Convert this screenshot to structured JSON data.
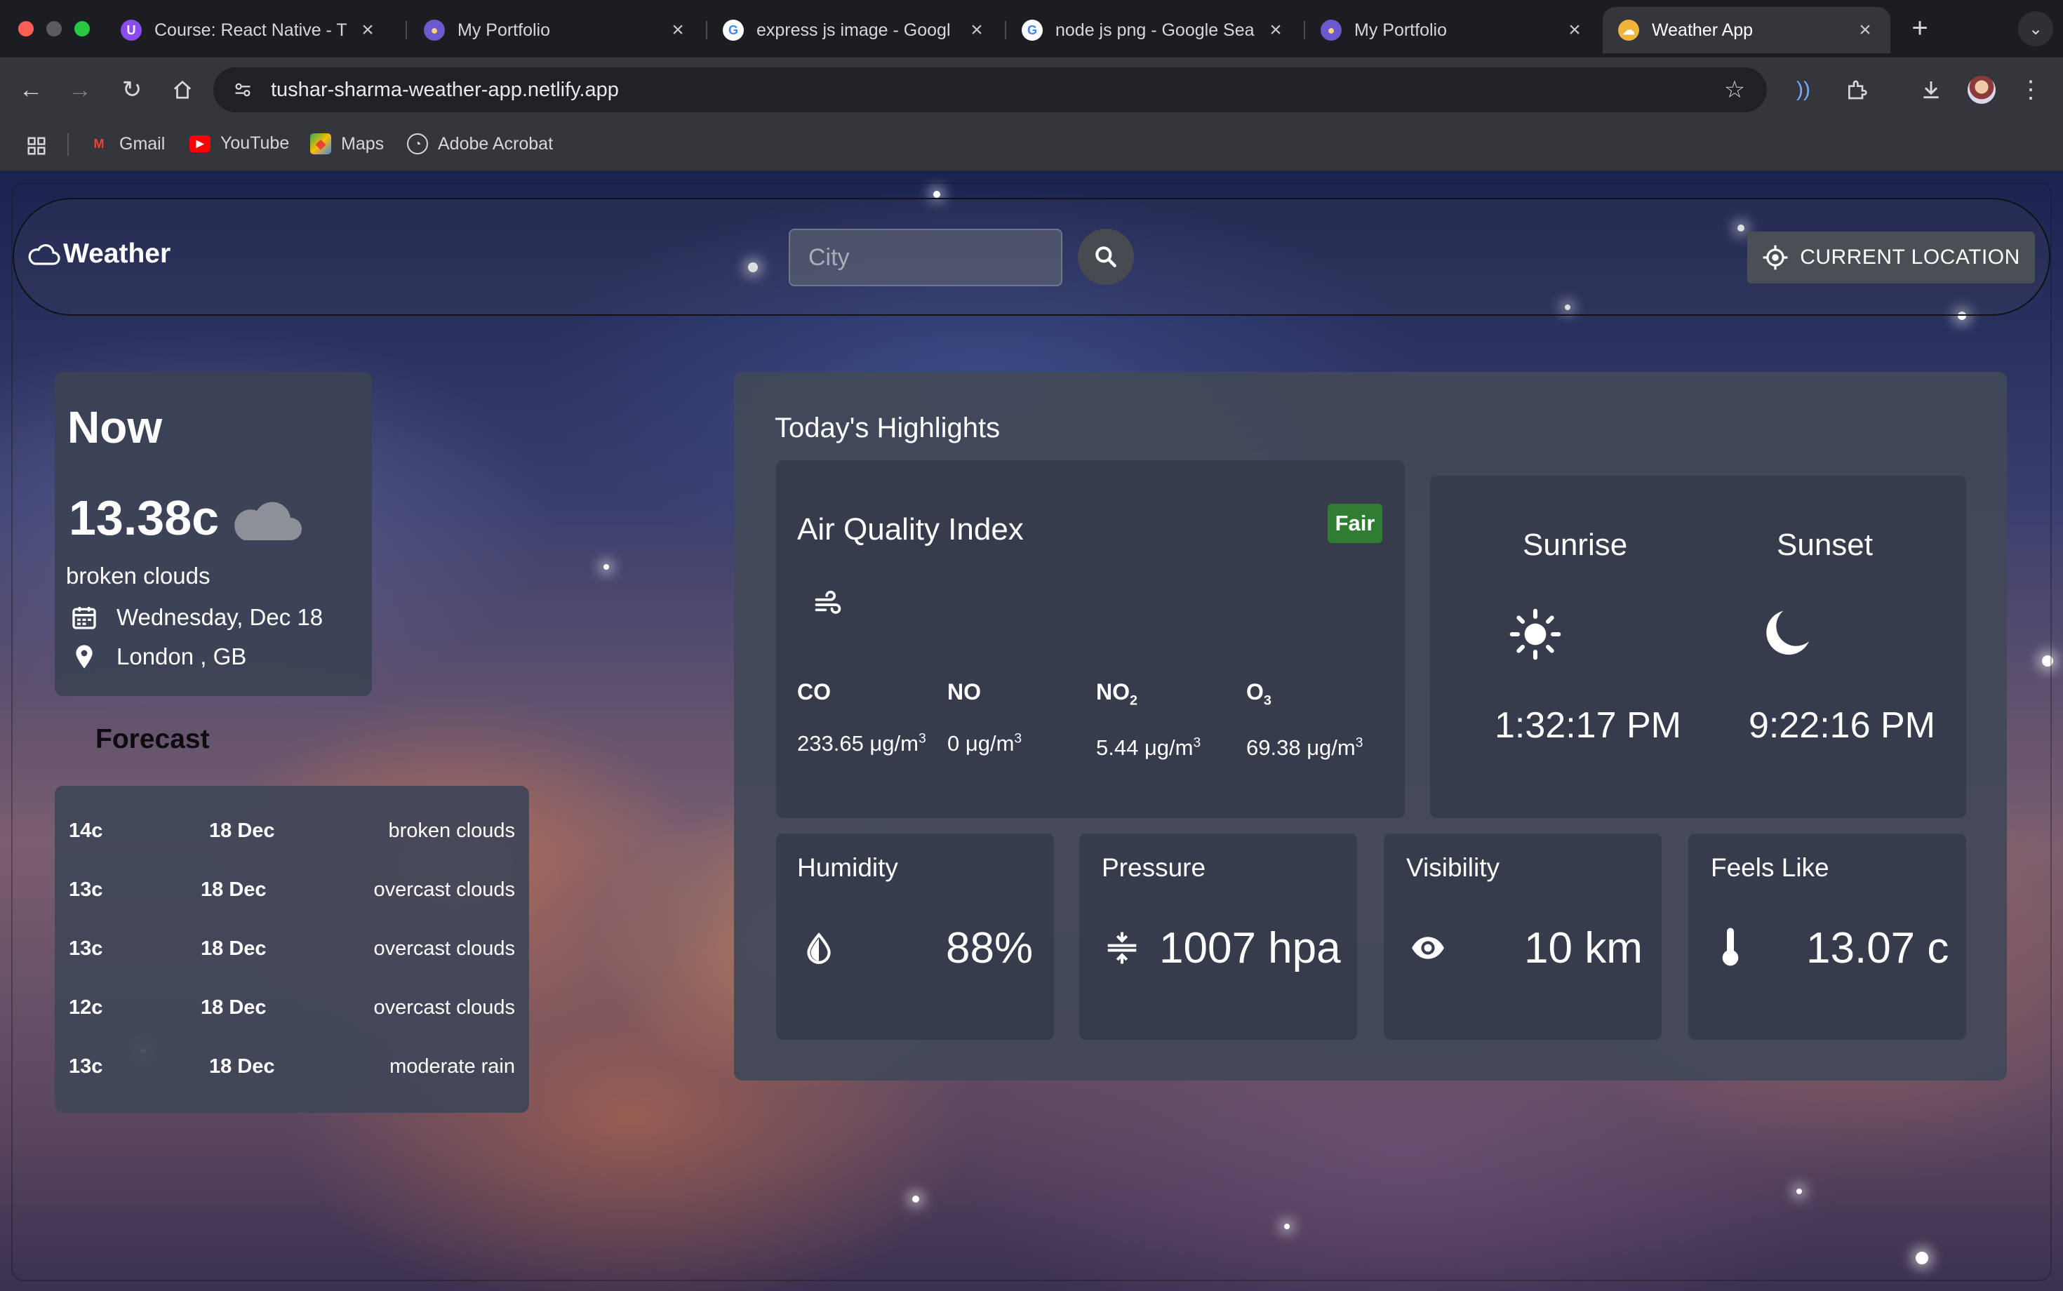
{
  "browser": {
    "tabs": [
      {
        "title": "Course: React Native - Th",
        "icon": "course-icon"
      },
      {
        "title": "My Portfolio",
        "icon": "portfolio-icon"
      },
      {
        "title": "express js image - Googl",
        "icon": "google-icon"
      },
      {
        "title": "node js png - Google Sea",
        "icon": "google-icon"
      },
      {
        "title": "My Portfolio",
        "icon": "portfolio-icon"
      },
      {
        "title": "Weather App",
        "icon": "weather-app-icon",
        "active": true
      }
    ],
    "url": "tushar-sharma-weather-app.netlify.app",
    "bookmarks": [
      {
        "label": "Gmail",
        "icon": "gmail-icon"
      },
      {
        "label": "YouTube",
        "icon": "youtube-icon"
      },
      {
        "label": "Maps",
        "icon": "maps-icon"
      },
      {
        "label": "Adobe Acrobat",
        "icon": "acrobat-icon"
      }
    ]
  },
  "header": {
    "brand": "Weather",
    "search_placeholder": "City",
    "location_button": "CURRENT LOCATION"
  },
  "now": {
    "title": "Now",
    "temp": "13.38c",
    "description": "broken clouds",
    "date": "Wednesday, Dec 18",
    "location": "London , GB"
  },
  "forecast": {
    "title": "Forecast",
    "rows": [
      {
        "temp": "14c",
        "date": "18 Dec",
        "desc": "broken clouds"
      },
      {
        "temp": "13c",
        "date": "18 Dec",
        "desc": "overcast clouds"
      },
      {
        "temp": "13c",
        "date": "18 Dec",
        "desc": "overcast clouds"
      },
      {
        "temp": "12c",
        "date": "18 Dec",
        "desc": "overcast clouds"
      },
      {
        "temp": "13c",
        "date": "18 Dec",
        "desc": "moderate rain"
      }
    ]
  },
  "highlights": {
    "title": "Today's Highlights",
    "aqi": {
      "title": "Air Quality Index",
      "badge": "Fair",
      "badge_color": "#2f7d32",
      "items": [
        {
          "base": "CO",
          "sub": "",
          "value": "233.65 μg/m",
          "unit_exp": "3"
        },
        {
          "base": "NO",
          "sub": "",
          "value": "0 μg/m",
          "unit_exp": "3"
        },
        {
          "base": "NO",
          "sub": "2",
          "value": "5.44 μg/m",
          "unit_exp": "3"
        },
        {
          "base": "O",
          "sub": "3",
          "value": "69.38 μg/m",
          "unit_exp": "3"
        }
      ]
    },
    "sun": {
      "sunrise_label": "Sunrise",
      "sunset_label": "Sunset",
      "sunrise": "1:32:17 PM",
      "sunset": "9:22:16 PM"
    },
    "stats": [
      {
        "label": "Humidity",
        "value": "88%",
        "icon": "humidity-icon"
      },
      {
        "label": "Pressure",
        "value": "1007 hpa",
        "icon": "pressure-icon"
      },
      {
        "label": "Visibility",
        "value": "10 km",
        "icon": "visibility-icon"
      },
      {
        "label": "Feels Like",
        "value": "13.07 c",
        "icon": "thermometer-icon"
      }
    ]
  }
}
